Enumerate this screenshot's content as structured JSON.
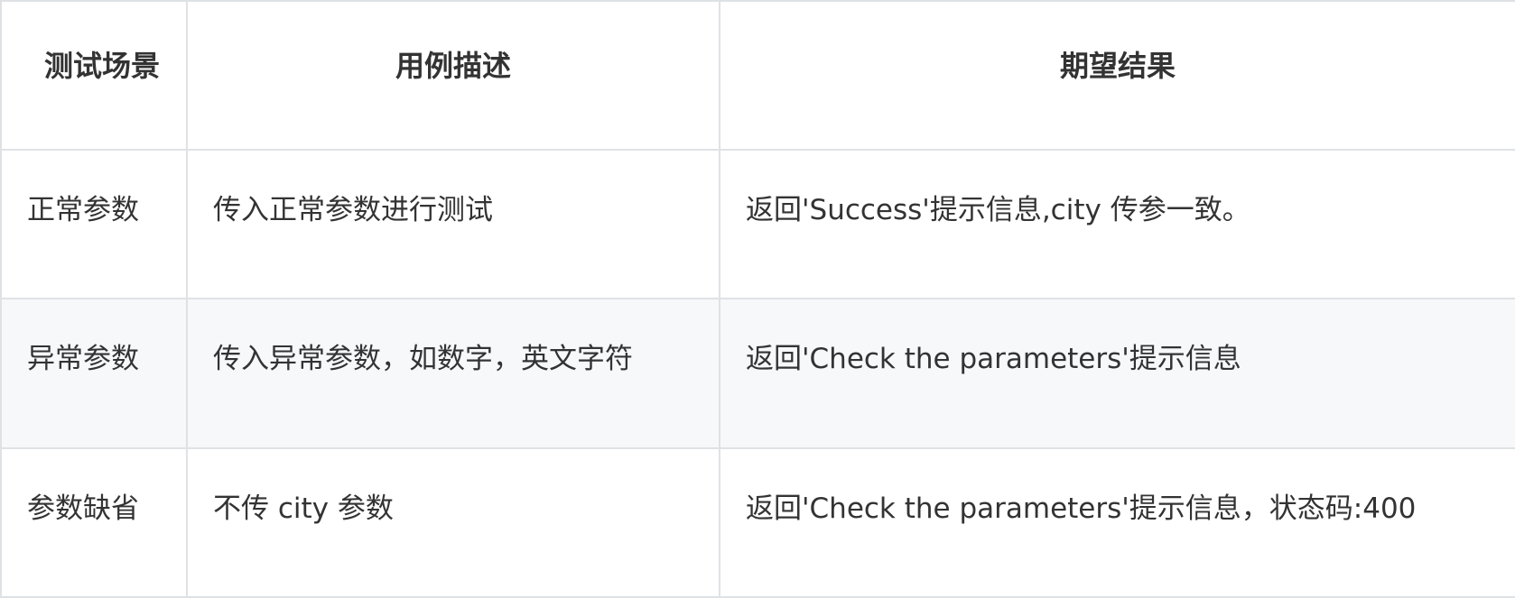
{
  "table": {
    "headers": [
      "测试场景",
      "用例描述",
      "期望结果"
    ],
    "rows": [
      [
        "正常参数",
        "传入正常参数进行测试",
        "返回'Success'提示信息,city 传参一致。"
      ],
      [
        "异常参数",
        "传入异常参数，如数字，英文字符",
        "返回'Check  the  parameters'提示信息"
      ],
      [
        "参数缺省",
        "不传 city 参数",
        "返回'Check  the  parameters'提示信息，状态码:400"
      ]
    ]
  }
}
